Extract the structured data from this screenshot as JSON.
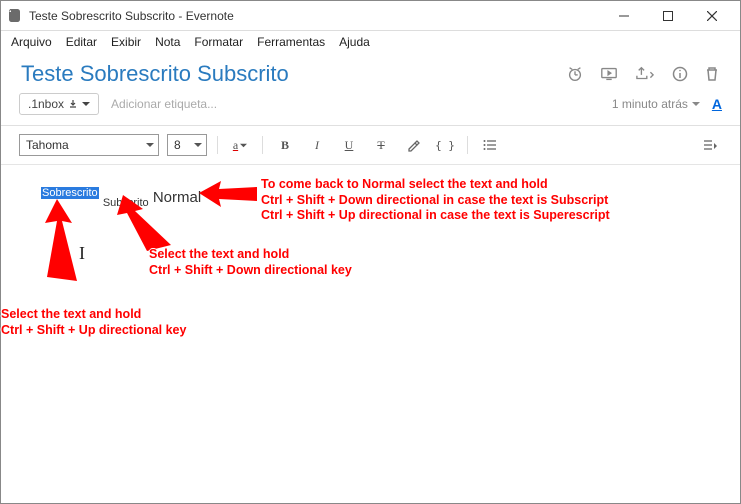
{
  "window": {
    "title": "Teste Sobrescrito Subscrito - Evernote"
  },
  "menubar": [
    "Arquivo",
    "Editar",
    "Exibir",
    "Nota",
    "Formatar",
    "Ferramentas",
    "Ajuda"
  ],
  "note": {
    "title": "Teste Sobrescrito Subscrito",
    "notebook": ".1nbox",
    "tag_placeholder": "Adicionar etiqueta...",
    "timestamp": "1 minuto atrás"
  },
  "toolbar": {
    "font": "Tahoma",
    "size": "8",
    "color_glyph": "a",
    "bold": "B",
    "italic": "I",
    "underline": "U",
    "strike": "T",
    "highlight": "✎",
    "code": "{ }",
    "font_color_btn": "A"
  },
  "content": {
    "superscript": "Sobrescrito",
    "subscript": "Subscrito",
    "normal": "Normal"
  },
  "annotations": {
    "right1": "To come back to Normal select the text and hold",
    "right2": "Ctrl + Shift + Down directional in case the text is Subscript",
    "right3": "Ctrl + Shift + Up directional in case the text is Superescript",
    "mid1": "Select the text and hold",
    "mid2": "Ctrl + Shift + Down directional key",
    "left1": "Select the text and hold",
    "left2": "Ctrl + Shift + Up directional key"
  }
}
